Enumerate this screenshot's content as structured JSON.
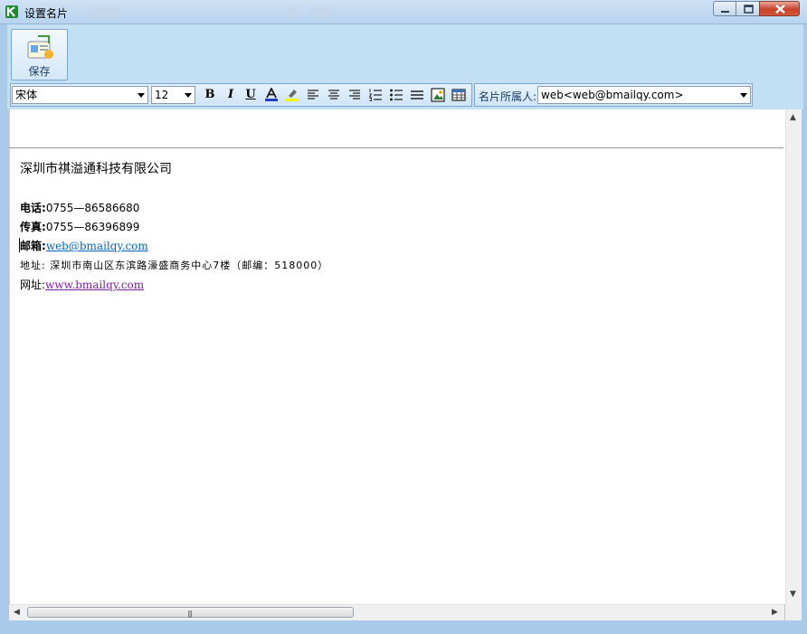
{
  "window": {
    "title": "设置名片",
    "controls": [
      "minimize-icon",
      "maximize-icon",
      "close-icon"
    ]
  },
  "toolbar": {
    "save_label": "保存",
    "save_icon": "save-card-icon"
  },
  "format": {
    "font_family": "宋体",
    "font_size": "12",
    "buttons": [
      {
        "name": "bold",
        "icon": "bold-icon",
        "glyph": "B"
      },
      {
        "name": "italic",
        "icon": "italic-icon",
        "glyph": "I"
      },
      {
        "name": "underline",
        "icon": "underline-icon",
        "glyph": "U"
      },
      {
        "name": "font-color",
        "icon": "font-color-icon",
        "glyph": "A"
      },
      {
        "name": "highlight",
        "icon": "highlighter-icon"
      },
      {
        "name": "align-left",
        "icon": "align-left-icon"
      },
      {
        "name": "align-center",
        "icon": "align-center-icon"
      },
      {
        "name": "align-right",
        "icon": "align-right-icon"
      },
      {
        "name": "numbered-list",
        "icon": "numbered-list-icon"
      },
      {
        "name": "bullet-list",
        "icon": "bullet-list-icon"
      },
      {
        "name": "horizontal-rule",
        "icon": "horizontal-rule-icon"
      },
      {
        "name": "insert-image",
        "icon": "insert-image-icon"
      },
      {
        "name": "insert-table",
        "icon": "insert-table-icon"
      }
    ]
  },
  "owner": {
    "label": "名片所属人:",
    "value": "web<web@bmailqy.com>"
  },
  "card": {
    "company": "深圳市祺溢通科技有限公司",
    "phone_label": "电话:",
    "phone": "0755—86586680",
    "fax_label": "传真:",
    "fax": "0755—86396899",
    "email_label": "邮箱:",
    "email": "web@bmailqy.com",
    "address_label": "地址:",
    "address": "深圳市南山区东滨路濠盛商务中心7楼（邮编：518000）",
    "website_label": "网址:",
    "website": "www.bmailqy.com"
  },
  "colors": {
    "titlebar": "#b7d3ef",
    "toolbar_bg": "#c3dff3",
    "link": "#0563c1",
    "visited_link": "#7b1fa2",
    "close_button": "#c8432a",
    "font_color_bar": "#1f3fbf",
    "highlight_bar": "#f5f500"
  }
}
